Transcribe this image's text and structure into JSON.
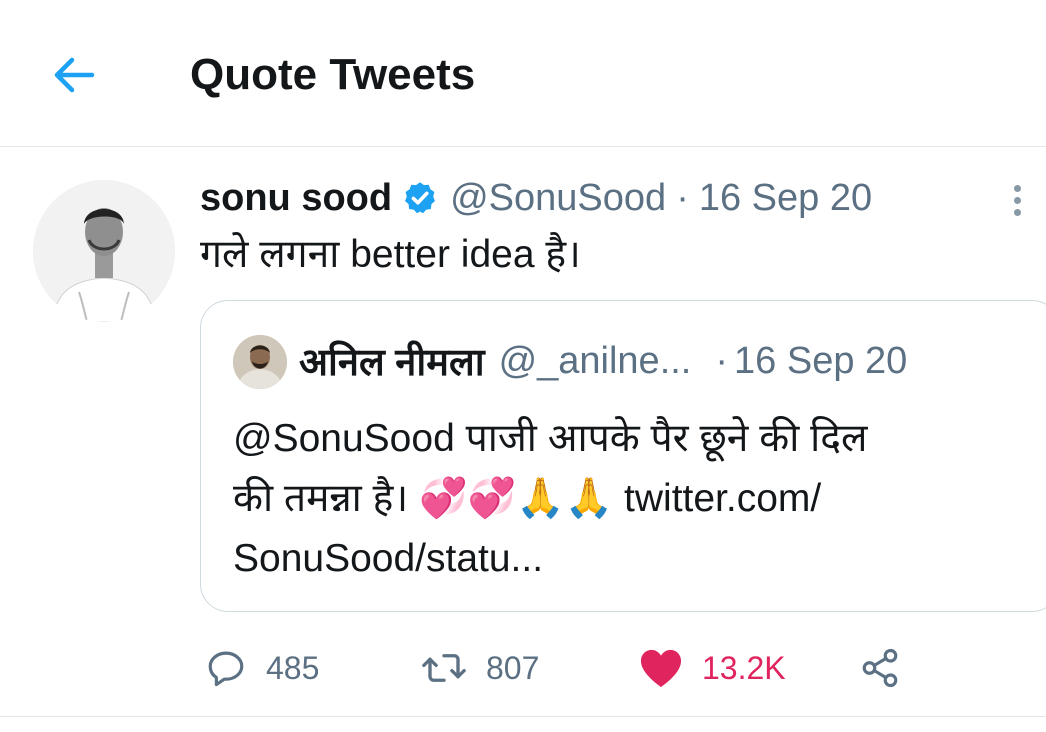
{
  "header": {
    "title": "Quote Tweets"
  },
  "tweet": {
    "display_name": "sonu sood",
    "handle": "@SonuSood",
    "separator": "·",
    "timestamp": "16 Sep 20",
    "text": "गले लगना better idea है।",
    "quote": {
      "display_name": "अनिल नीमला",
      "handle": "@_anilne...",
      "separator": "·",
      "timestamp": "16 Sep 20",
      "text_line1": "@SonuSood  पाजी आपके पैर छूने की दिल",
      "text_line2_prefix": "की तमन्ना है। ",
      "text_emojis": "💞💞🙏🙏",
      "text_line2_suffix": " twitter.com/",
      "text_line3": "SonuSood/statu..."
    },
    "actions": {
      "replies": "485",
      "retweets": "807",
      "likes": "13.2K",
      "liked": true
    }
  },
  "colors": {
    "accent": "#1da1f2",
    "like": "#e0245e",
    "secondary_text": "#5b7083",
    "divider": "#e1e8ed"
  },
  "icons": {
    "back": "arrow-left-icon",
    "verified": "verified-badge-icon",
    "more": "more-vertical-icon",
    "reply": "reply-icon",
    "retweet": "retweet-icon",
    "like": "heart-icon",
    "share": "share-icon"
  }
}
